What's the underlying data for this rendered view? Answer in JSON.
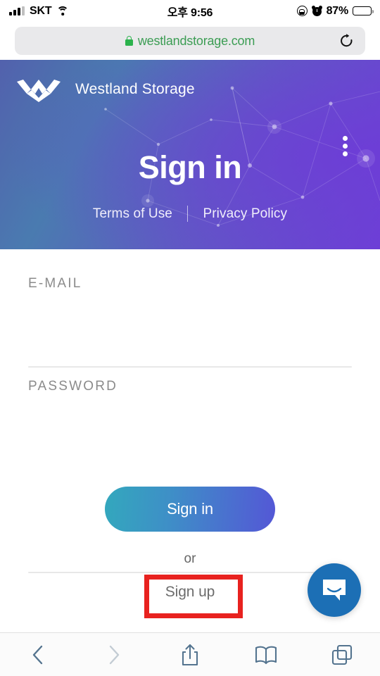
{
  "status_bar": {
    "carrier": "SKT",
    "time": "오후 9:56",
    "battery_percent": "87%",
    "signal_icon": "cellular-signal-icon",
    "wifi_icon": "wifi-icon",
    "rotation_lock_icon": "rotation-lock-icon",
    "alarm_icon": "alarm-clock-icon",
    "battery_icon": "battery-icon",
    "battery_level": 87
  },
  "browser": {
    "url": "westlandstorage.com",
    "lock_icon": "secure-lock-icon",
    "reload_icon": "reload-icon",
    "url_text_color": "#3c9d54",
    "lock_color": "#2bb24c"
  },
  "hero": {
    "brand": "Westland Storage",
    "logo_icon": "westland-w-logo-icon",
    "menu_icon": "kebab-menu-icon",
    "title": "Sign in",
    "links": [
      {
        "label": "Terms of Use",
        "name": "terms-of-use-link"
      },
      {
        "label": "Privacy Policy",
        "name": "privacy-policy-link"
      }
    ],
    "gradient_from": "#4a7bb0",
    "gradient_to": "#6d3fd6"
  },
  "form": {
    "email": {
      "label": "E-MAIL",
      "value": "",
      "placeholder": ""
    },
    "password": {
      "label": "PASSWORD",
      "value": "",
      "placeholder": ""
    },
    "submit_label": "Sign in",
    "or_label": "or",
    "signup_label": "Sign up",
    "submit_gradient_from": "#33a8bd",
    "submit_gradient_to": "#5457d6",
    "highlight_color": "#e8221f"
  },
  "chat_widget": {
    "icon": "intercom-chat-bubble-icon",
    "color": "#1c6fb5"
  },
  "toolbar": {
    "items": [
      {
        "name": "back-button",
        "icon": "chevron-left-icon",
        "enabled": true
      },
      {
        "name": "forward-button",
        "icon": "chevron-right-icon",
        "enabled": false
      },
      {
        "name": "share-button",
        "icon": "share-icon",
        "enabled": true
      },
      {
        "name": "bookmarks-button",
        "icon": "book-icon",
        "enabled": true
      },
      {
        "name": "tabs-button",
        "icon": "tabs-icon",
        "enabled": true
      }
    ],
    "active_color": "#54748f",
    "disabled_color": "#c3ccd4"
  }
}
